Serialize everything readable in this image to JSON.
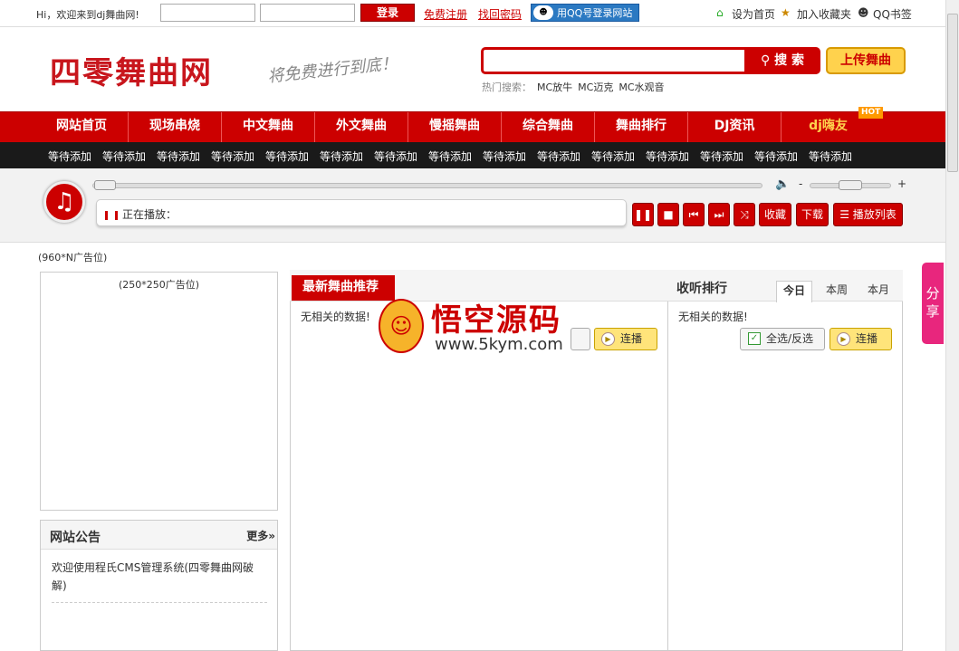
{
  "topbar": {
    "welcome": "Hi，欢迎来到dj舞曲网!",
    "login_label": "登录",
    "register_link": "免费注册",
    "recover_link": "找回密码",
    "qq_login": "用QQ号登录网站",
    "set_home": "设为首页",
    "add_fav": "加入收藏夹",
    "qq_bookmark": "QQ书签"
  },
  "header": {
    "logo": "四零舞曲网",
    "slogan": "将免费进行到底！",
    "search_button": "搜 索",
    "upload_button": "上传舞曲",
    "hot_label": "热门搜索：",
    "hot_items": [
      "MC放牛",
      "MC迈克",
      "MC水观音"
    ]
  },
  "nav": {
    "items": [
      "网站首页",
      "现场串烧",
      "中文舞曲",
      "外文舞曲",
      "慢摇舞曲",
      "综合舞曲",
      "舞曲排行",
      "DJ资讯",
      "dj嗨友"
    ],
    "hot_badge": "HOT"
  },
  "subnav": {
    "items": [
      "等待添加",
      "等待添加",
      "等待添加",
      "等待添加",
      "等待添加",
      "等待添加",
      "等待添加",
      "等待添加",
      "等待添加",
      "等待添加",
      "等待添加",
      "等待添加",
      "等待添加",
      "等待添加",
      "等待添加"
    ]
  },
  "player": {
    "now_playing": "正在播放：",
    "collect": "收藏",
    "download": "下载",
    "playlist": "播放列表",
    "vol_minus": "-",
    "vol_plus": "+"
  },
  "ads": {
    "banner": "(960*N广告位)",
    "left": "(250*250广告位)"
  },
  "notice": {
    "title": "网站公告",
    "more": "更多»",
    "content": "欢迎使用程氏CMS管理系统(四零舞曲网破解)"
  },
  "latest": {
    "title": "最新舞曲推荐",
    "no_data": "无相关的数据!",
    "play_all": "连播"
  },
  "ranking": {
    "title": "收听排行",
    "tabs": [
      "今日",
      "本周",
      "本月"
    ],
    "no_data": "无相关的数据!",
    "select_all": "全选/反选",
    "play_all": "连播"
  },
  "share": {
    "label": "分享"
  },
  "watermark": {
    "cn": "悟空源码",
    "url": "www.5kym.com"
  },
  "colors": {
    "brand_red": "#cc0000",
    "subnav_bg": "#1a1a1a",
    "share_pink": "#e8267d"
  }
}
